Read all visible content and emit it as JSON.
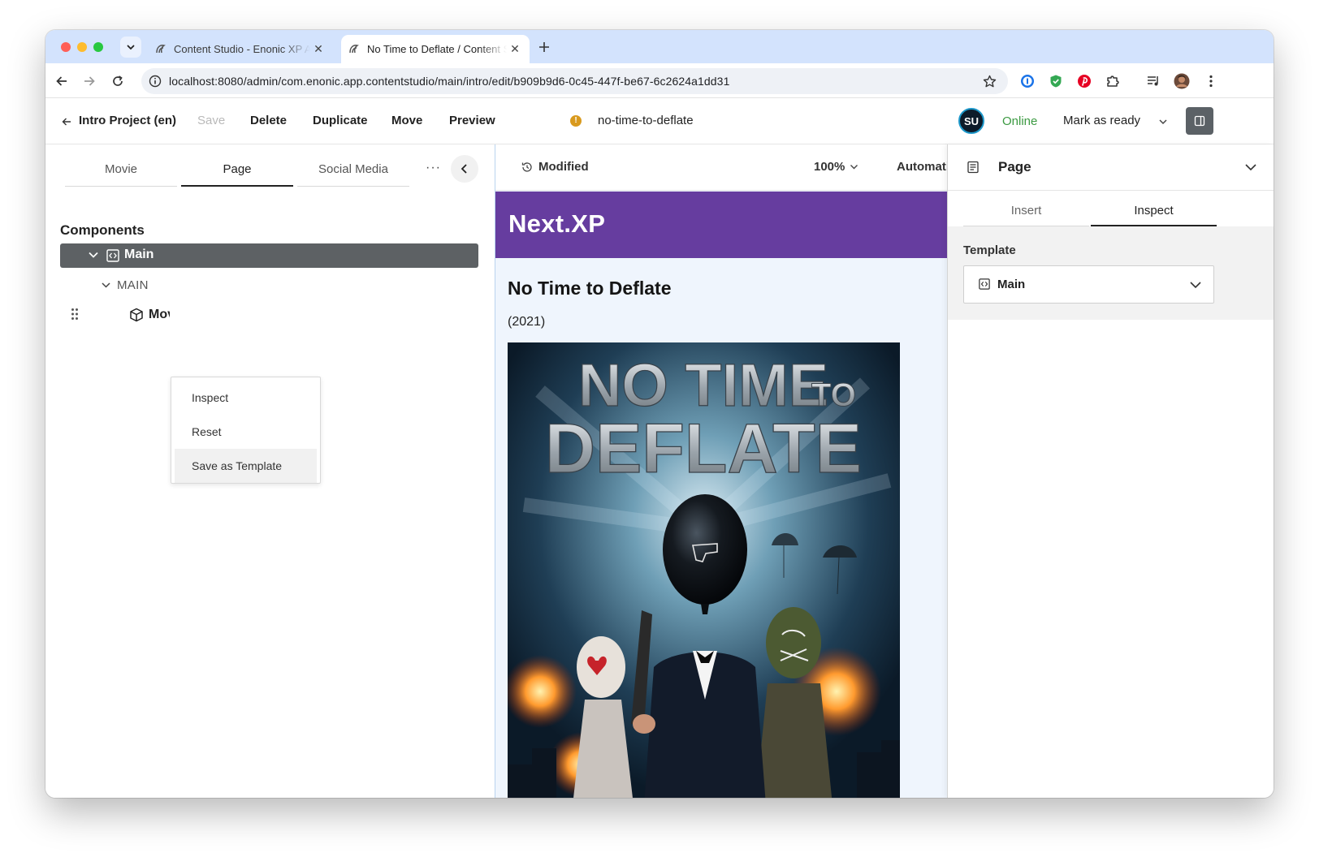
{
  "browser": {
    "tabs": [
      {
        "title": "Content Studio - Enonic XP Admin"
      },
      {
        "title": "No Time to Deflate / Content Studio"
      }
    ],
    "url": "localhost:8080/admin/com.enonic.app.contentstudio/main/intro/edit/b909b9d6-0c45-447f-be67-6c2624a1dd31",
    "traffic_lights": [
      "#ff5f57",
      "#febc2e",
      "#28c840"
    ]
  },
  "appbar": {
    "back_label": "Intro Project (en)",
    "save_label": "Save",
    "delete_label": "Delete",
    "duplicate_label": "Duplicate",
    "move_label": "Move",
    "preview_label": "Preview",
    "content_name": "no-time-to-deflate",
    "avatar_initials": "SU",
    "status": "Online",
    "workflow_label": "Mark as ready"
  },
  "left_panel": {
    "tabs": [
      {
        "label": "Movie",
        "active": false
      },
      {
        "label": "Page",
        "active": true
      },
      {
        "label": "Social Media",
        "active": false
      }
    ],
    "more_label": "···",
    "components_label": "Components",
    "tree": {
      "main_label": "Main",
      "region_label": "MAIN",
      "part_label": "Movie"
    },
    "context_menu": [
      {
        "label": "Inspect"
      },
      {
        "label": "Reset"
      },
      {
        "label": "Save as Template"
      }
    ]
  },
  "preview": {
    "status": "Modified",
    "zoom": "100%",
    "mode": "Automatic",
    "site_name": "Next.XP",
    "movie_title": "No Time to Deflate",
    "movie_year": "(2021)",
    "poster_title_line1": "NO TIME",
    "poster_title_to": "TO",
    "poster_title_line2": "DEFLATE",
    "colors": {
      "header": "#663d9f",
      "background": "#eff5fd"
    }
  },
  "right_panel": {
    "title": "Page",
    "tabs": [
      {
        "label": "Insert",
        "active": false
      },
      {
        "label": "Inspect",
        "active": true
      }
    ],
    "template_label": "Template",
    "template_value": "Main"
  }
}
